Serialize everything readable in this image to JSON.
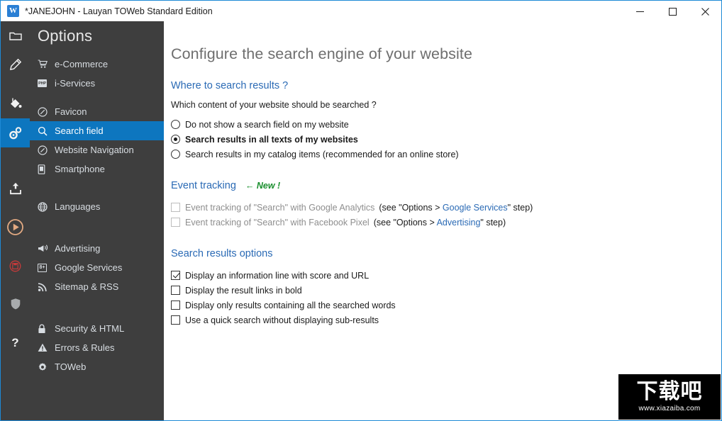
{
  "window": {
    "title": "*JANEJOHN - Lauyan TOWeb Standard Edition",
    "app_icon": "toweb-app-icon",
    "minimize_label": "—",
    "maximize_label": "☐",
    "close_label": "✕",
    "border_color": "#1e8ad6"
  },
  "rail": {
    "items": [
      {
        "icon": "folder-icon",
        "active": false
      },
      {
        "icon": "pencil-icon",
        "active": false
      },
      {
        "icon": "paint-bucket-icon",
        "active": false
      },
      {
        "icon": "gears-icon",
        "active": true
      },
      {
        "icon": "upload-icon",
        "active": false
      },
      {
        "icon": "play-icon",
        "active": false
      },
      {
        "icon": "save-icon",
        "active": false
      },
      {
        "icon": "shield-icon",
        "active": false
      },
      {
        "icon": "help-icon",
        "active": false
      }
    ],
    "active_color": "#0d76bf",
    "background": "#3e3e3e"
  },
  "sidebar": {
    "header": "Options",
    "header_icon": "folder-icon",
    "background": "#3e3e3e",
    "selected_color": "#0d76bf",
    "groups": [
      {
        "items": [
          {
            "label": "e-Commerce",
            "icon": "shopping-cart-icon",
            "selected": false
          },
          {
            "label": "i-Services",
            "icon": "php-badge-icon",
            "selected": false
          }
        ]
      },
      {
        "items": [
          {
            "label": "Favicon",
            "icon": "circle-slash-icon",
            "selected": false
          },
          {
            "label": "Search field",
            "icon": "search-icon",
            "selected": true
          },
          {
            "label": "Website Navigation",
            "icon": "compass-icon",
            "selected": false
          },
          {
            "label": "Smartphone",
            "icon": "smartphone-icon",
            "selected": false
          }
        ]
      },
      {
        "items": [
          {
            "label": "Languages",
            "icon": "globe-icon",
            "selected": false
          }
        ]
      },
      {
        "items": [
          {
            "label": "Advertising",
            "icon": "megaphone-icon",
            "selected": false
          },
          {
            "label": "Google Services",
            "icon": "google-plus-icon",
            "selected": false
          },
          {
            "label": "Sitemap & RSS",
            "icon": "rss-icon",
            "selected": false
          }
        ]
      },
      {
        "items": [
          {
            "label": "Security & HTML",
            "icon": "lock-icon",
            "selected": false
          },
          {
            "label": "Errors & Rules",
            "icon": "warning-icon",
            "selected": false
          },
          {
            "label": "TOWeb",
            "icon": "gear-icon",
            "selected": false
          }
        ]
      }
    ]
  },
  "main": {
    "page_title": "Configure the search engine of your website",
    "sections": {
      "where": {
        "title": "Where to search results ?",
        "question": "Which content of your website should be searched ?",
        "options": [
          {
            "label": "Do not show a search field on my website",
            "checked": false
          },
          {
            "label": "Search results in all texts of my websites",
            "checked": true
          },
          {
            "label": "Search results in my catalog items (recommended for an online store)",
            "checked": false
          }
        ]
      },
      "event_tracking": {
        "title": "Event tracking",
        "new_tag": "← New !",
        "new_tag_color": "#1a8f2e",
        "options": [
          {
            "label": "Event tracking of \"Search\" with Google Analytics",
            "hint_before": "(see \"Options > ",
            "hint_link": "Google Services",
            "hint_after": "\" step)",
            "checked": false,
            "disabled": true
          },
          {
            "label": "Event tracking of \"Search\" with Facebook Pixel",
            "hint_before": "(see \"Options > ",
            "hint_link": "Advertising",
            "hint_after": "\" step)",
            "checked": false,
            "disabled": true
          }
        ]
      },
      "results_options": {
        "title": "Search results options",
        "options": [
          {
            "label": "Display an information line with score and URL",
            "checked": true
          },
          {
            "label": "Display the result links in bold",
            "checked": false
          },
          {
            "label": "Display only results containing all the searched words",
            "checked": false
          },
          {
            "label": "Use a quick search without displaying sub-results",
            "checked": false
          }
        ]
      }
    }
  },
  "watermark": {
    "text": "下载吧",
    "url": "www.xiazaiba.com"
  }
}
